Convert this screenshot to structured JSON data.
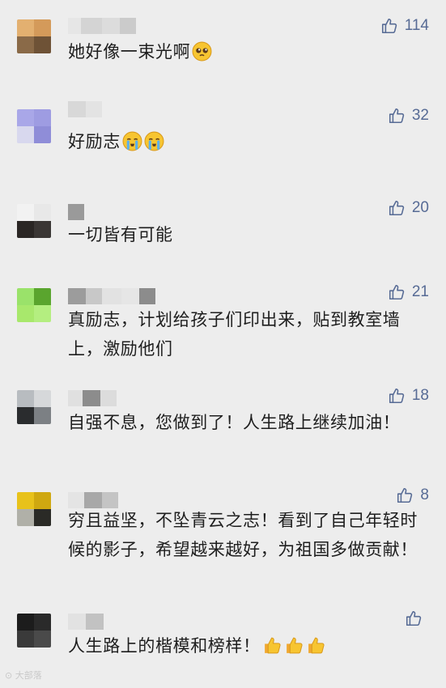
{
  "comments": [
    {
      "text": "她好像一束光啊",
      "likes": "114",
      "emojis": [
        "pleading-face"
      ]
    },
    {
      "text": "好励志",
      "likes": "32",
      "emojis": [
        "loudly-crying-face",
        "loudly-crying-face"
      ]
    },
    {
      "text": "一切皆有可能",
      "likes": "20",
      "emojis": []
    },
    {
      "text": "真励志，计划给孩子们印出来，贴到教室墙上，激励他们",
      "likes": "21",
      "emojis": []
    },
    {
      "text": "自强不息，您做到了！人生路上继续加油！",
      "likes": "18",
      "emojis": []
    },
    {
      "text": "穷且益坚，不坠青云之志！看到了自己年轻时候的影子，希望越来越好，为祖国多做贡献！",
      "likes": "8",
      "emojis": []
    },
    {
      "text": "人生路上的楷模和榜样！",
      "likes": "",
      "emojis": [
        "thumbs-up",
        "thumbs-up",
        "thumbs-up"
      ]
    }
  ],
  "watermark": "大部落",
  "colors": {
    "background": "#ededed",
    "text": "#1e1e1e",
    "like": "#576b95"
  }
}
